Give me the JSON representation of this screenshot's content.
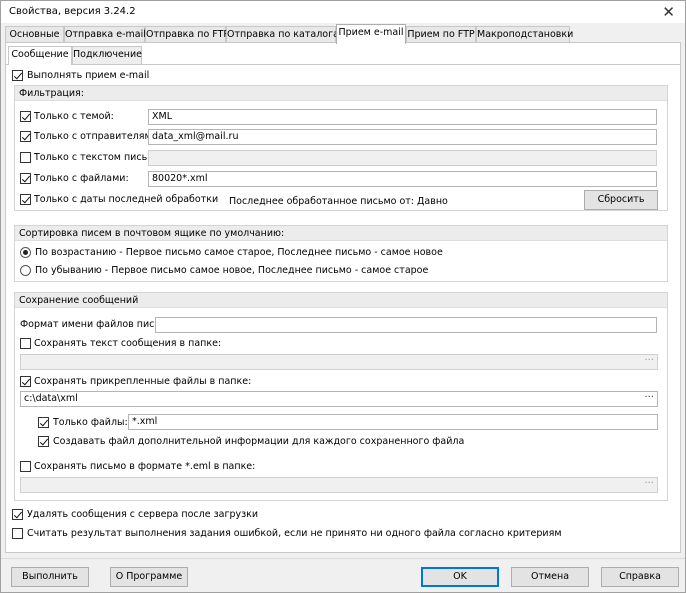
{
  "window": {
    "title": "Свойства, версия 3.24.2"
  },
  "tabs": [
    {
      "label": "Основные"
    },
    {
      "label": "Отправка e-mail"
    },
    {
      "label": "Отправка по FTP"
    },
    {
      "label": "Отправка по каталогам"
    },
    {
      "label": "Прием e-mail"
    },
    {
      "label": "Прием по FTP"
    },
    {
      "label": "Макроподстановки"
    }
  ],
  "active_tab": "Прием e-mail",
  "subtabs": [
    {
      "label": "Сообщение"
    },
    {
      "label": "Подключение"
    }
  ],
  "enable_receive": {
    "label": "Выполнять прием e-mail",
    "checked": true
  },
  "filter": {
    "title": "Фильтрация:",
    "subject": {
      "label": "Только с темой:",
      "checked": true,
      "value": "XML"
    },
    "senders": {
      "label": "Только с отправителями:",
      "checked": true,
      "value": "data_xml@mail.ru"
    },
    "body_text": {
      "label": "Только с текстом письма:",
      "checked": false,
      "value": ""
    },
    "files": {
      "label": "Только с файлами:",
      "checked": true,
      "value": "80020*.xml"
    },
    "since_last": {
      "label": "Только с даты последней обработки",
      "checked": true
    },
    "last_processed": "Последнее обработанное письмо от: Давно",
    "reset_label": "Сбросить"
  },
  "sort": {
    "title": "Сортировка писем в почтовом ящике по умолчанию:",
    "asc": {
      "label": "По возрастанию - Первое письмо самое старое, Последнее письмо - самое новое",
      "checked": true
    },
    "desc": {
      "label": "По убыванию - Первое письмо самое новое, Последнее письмо - самое старое",
      "checked": false
    }
  },
  "save": {
    "title": "Сохранение сообщений",
    "name_format_label": "Формат имени файлов писем:",
    "name_format_value": "",
    "save_text": {
      "label": "Сохранять текст сообщения в папке:",
      "checked": false,
      "path": ""
    },
    "save_attachments": {
      "label": "Сохранять прикрепленные файлы в папке:",
      "checked": true,
      "path": "c:\\data\\xml"
    },
    "only_files": {
      "label": "Только файлы:",
      "checked": true,
      "value": "*.xml"
    },
    "create_info": {
      "label": "Создавать файл дополнительной информации для каждого сохраненного файла",
      "checked": true
    },
    "save_eml": {
      "label": "Сохранять письмо в формате *.eml в папке:",
      "checked": false,
      "path": ""
    },
    "browse_glyph": "···"
  },
  "delete_after": {
    "label": "Удалять сообщения с сервера после загрузки",
    "checked": true
  },
  "error_if_none": {
    "label": "Считать результат выполнения задания ошибкой, если не принято ни одного файла согласно критериям",
    "checked": false
  },
  "footer": {
    "run": "Выполнить",
    "about": "О Программе",
    "ok": "OK",
    "cancel": "Отмена",
    "help": "Справка"
  }
}
